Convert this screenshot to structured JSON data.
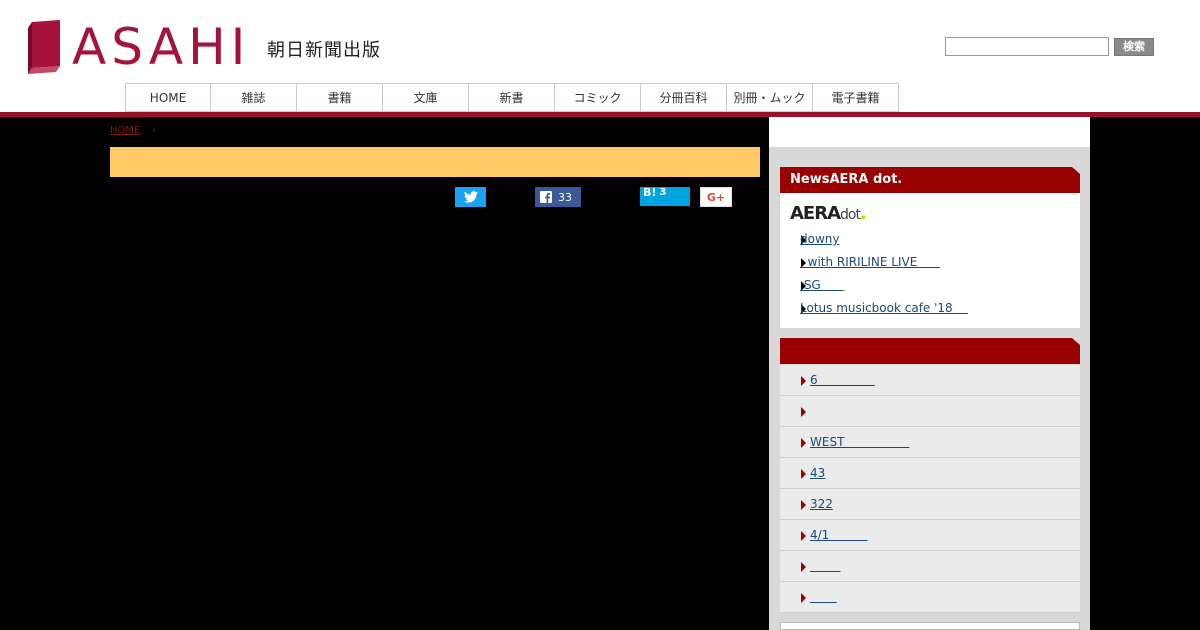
{
  "header": {
    "logo_text": "ASAHI",
    "logo_subtitle": "朝日新聞出版",
    "search_placeholder": "",
    "search_button": "検索",
    "brand_color": "#a5123a"
  },
  "nav": {
    "items": [
      "HOME",
      "雑誌",
      "書籍",
      "文庫",
      "新書",
      "コミック",
      "分冊百科",
      "別冊・ムック",
      "電子書籍"
    ]
  },
  "breadcrumb": {
    "home": "HOME",
    "separator": "›"
  },
  "share": {
    "twitter_icon": "twitter-icon",
    "facebook_count": "33",
    "hatena_label": "B!",
    "hatena_count": "3",
    "gplus_label": "G+"
  },
  "sidebar": {
    "news_title": "NewsAERA dot.",
    "aera_logo_main": "AERA",
    "aera_logo_dot": "dot",
    "news_items": [
      "downy",
      "  with RIRILINE LIVE      ",
      " SG      ",
      "Lotus musicbook cafe '18    "
    ],
    "ranking_title": "",
    "ranking_items": [
      "6               ",
      "",
      "WEST                 ",
      "43",
      "322",
      "4/1          ",
      "        ",
      "       "
    ]
  }
}
